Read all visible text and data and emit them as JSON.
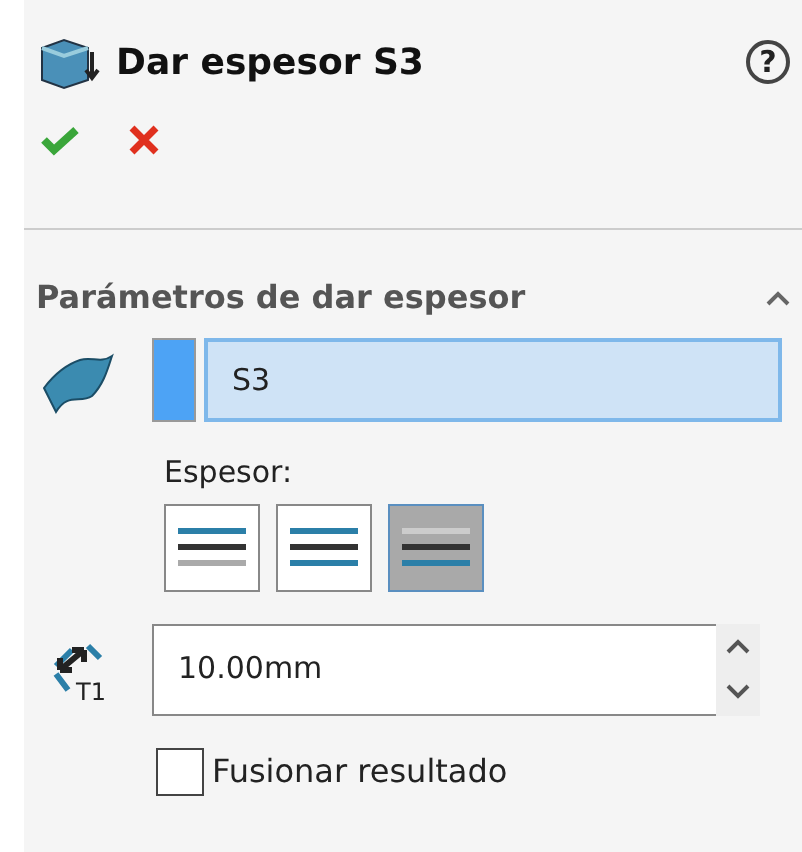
{
  "header": {
    "title": "Dar espesor S3",
    "help": "?"
  },
  "section": {
    "title": "Parámetros de dar espesor",
    "expanded": true,
    "selection": {
      "value": "S3"
    },
    "thickness": {
      "label": "Espesor:",
      "options": [
        {
          "kind": "side1",
          "selected": false
        },
        {
          "kind": "both",
          "selected": false
        },
        {
          "kind": "side2",
          "selected": true
        }
      ]
    },
    "distance": {
      "icon_label": "T1",
      "value": "10.00mm"
    },
    "merge": {
      "label": "Fusionar resultado",
      "checked": false
    }
  }
}
